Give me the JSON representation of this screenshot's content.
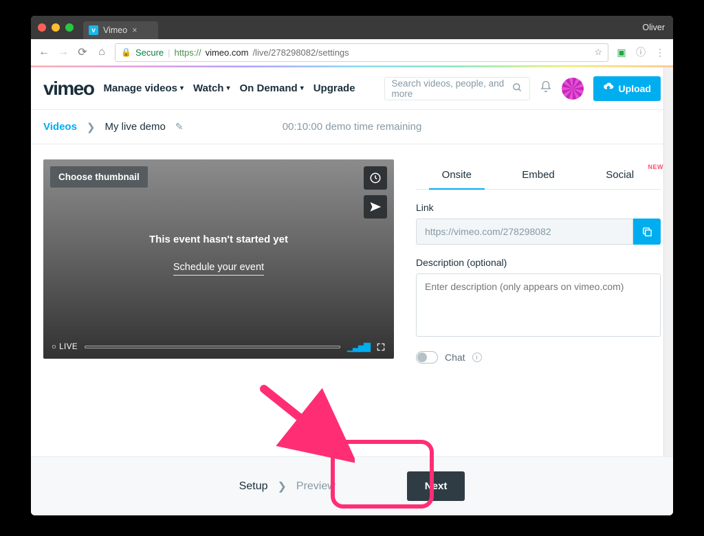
{
  "browser": {
    "tab_title": "Vimeo",
    "username": "Oliver",
    "secure_label": "Secure",
    "url_prefix": "https://",
    "url_host": "vimeo.com",
    "url_path": "/live/278298082/settings"
  },
  "header": {
    "logo": "vimeo",
    "nav": {
      "manage": "Manage videos",
      "watch": "Watch",
      "ondemand": "On Demand",
      "upgrade": "Upgrade"
    },
    "search_placeholder": "Search videos, people, and more",
    "upload_label": "Upload"
  },
  "breadcrumb": {
    "videos": "Videos",
    "title": "My live demo",
    "status": "00:10:00  demo time remaining"
  },
  "player": {
    "choose_thumb": "Choose thumbnail",
    "not_started": "This event hasn't started yet",
    "schedule": "Schedule your event",
    "live_label": "LIVE"
  },
  "tabs": {
    "onsite": "Onsite",
    "embed": "Embed",
    "social": "Social",
    "new_badge": "NEW"
  },
  "link": {
    "label": "Link",
    "value": "https://vimeo.com/278298082"
  },
  "description": {
    "label": "Description (optional)",
    "placeholder": "Enter description (only appears on vimeo.com)"
  },
  "chat": {
    "label": "Chat"
  },
  "steps": {
    "setup": "Setup",
    "preview": "Preview",
    "next": "Next"
  }
}
